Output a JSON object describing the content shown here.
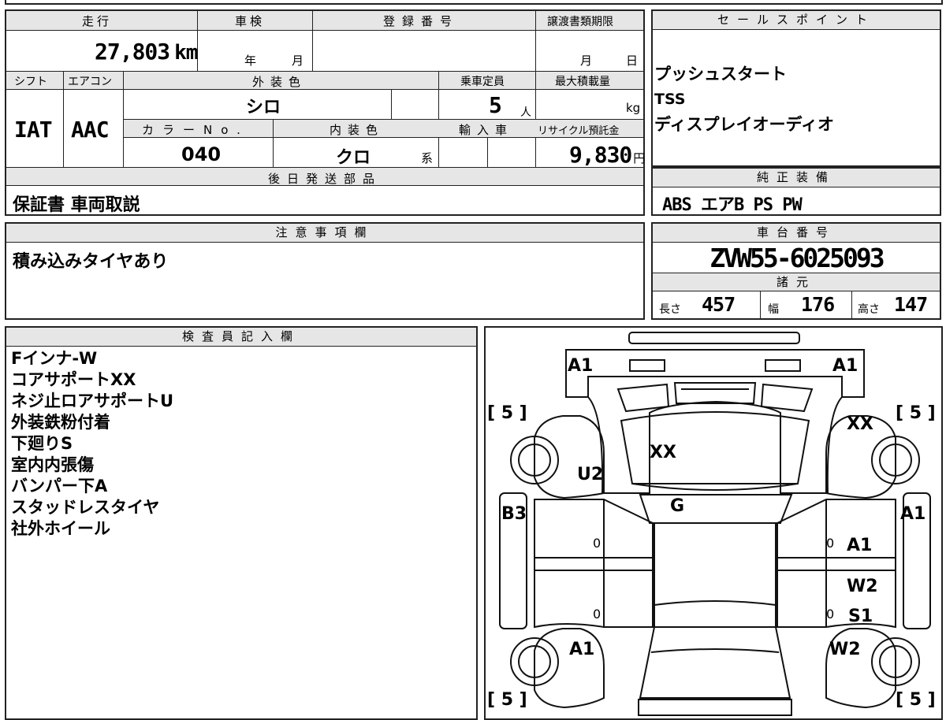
{
  "top": {
    "mileage_label": "走行",
    "mileage_value": "27,803",
    "mileage_unit": "km",
    "inspection_label": "車検",
    "inspection_year_unit": "年",
    "inspection_month_unit": "月",
    "registration_label": "登録番号",
    "transfer_deadline_label": "譲渡書類期限",
    "transfer_month_unit": "月",
    "transfer_day_unit": "日",
    "shift_label": "シフト",
    "shift_value": "IAT",
    "aircon_label": "エアコン",
    "aircon_value": "AAC",
    "exterior_color_label": "外装色",
    "exterior_color_value": "シロ",
    "capacity_label": "乗車定員",
    "capacity_value": "5",
    "capacity_unit": "人",
    "max_load_label": "最大積載量",
    "max_load_unit": "kg",
    "color_no_label": "カラーNo.",
    "color_no_value": "040",
    "interior_color_label": "内装色",
    "interior_color_value": "クロ",
    "interior_color_suffix": "系",
    "import_label": "輸入車",
    "recycle_label": "リサイクル預託金",
    "recycle_value": "9,830",
    "recycle_unit": "円",
    "later_parts_label": "後日発送部品",
    "later_parts_value": "保証書 車両取説"
  },
  "sales_points": {
    "header": "セールスポイント",
    "items": [
      "プッシュスタート",
      "TSS",
      "ディスプレイオーディオ"
    ]
  },
  "genuine_equipment": {
    "header": "純正装備",
    "value": "ABS エアB PS PW"
  },
  "caution": {
    "header": "注意事項欄",
    "value": "積み込みタイヤあり"
  },
  "chassis": {
    "header": "車台番号",
    "value": "ZVW55-6025093",
    "specs_header": "諸元",
    "length_label": "長さ",
    "length_value": "457",
    "width_label": "幅",
    "width_value": "176",
    "height_label": "高さ",
    "height_value": "147"
  },
  "inspector": {
    "header": "検査員記入欄",
    "notes": [
      "Fインナ-W",
      "コアサポートXX",
      "ネジ止ロアサポートU",
      "外装鉄粉付着",
      "下廻りS",
      "室内内張傷",
      "バンパー下A",
      "スタッドレスタイヤ",
      "社外ホイール"
    ]
  },
  "diagram": {
    "front_left_marks": "A1",
    "front_right_marks": "A1",
    "tire_fl": "[ 5 ]",
    "tire_fr": "[ 5 ]",
    "tire_rl": "[ 5 ]",
    "tire_rr": "[ 5 ]",
    "hood_mark": "XX",
    "right_fender_mark": "XX",
    "left_fender_mark": "U2",
    "roof_mark": "G",
    "left_pillar_mark": "B3",
    "right_pillar_mark": "A1",
    "right_front_door_mark": "A1",
    "right_rear_door_mark": "W2",
    "right_sill_mark": "S1",
    "rear_left_mark": "A1",
    "rear_right_mark": "W2",
    "door_zero_1": "0",
    "door_zero_2": "0",
    "door_zero_3": "0",
    "door_zero_4": "0"
  }
}
